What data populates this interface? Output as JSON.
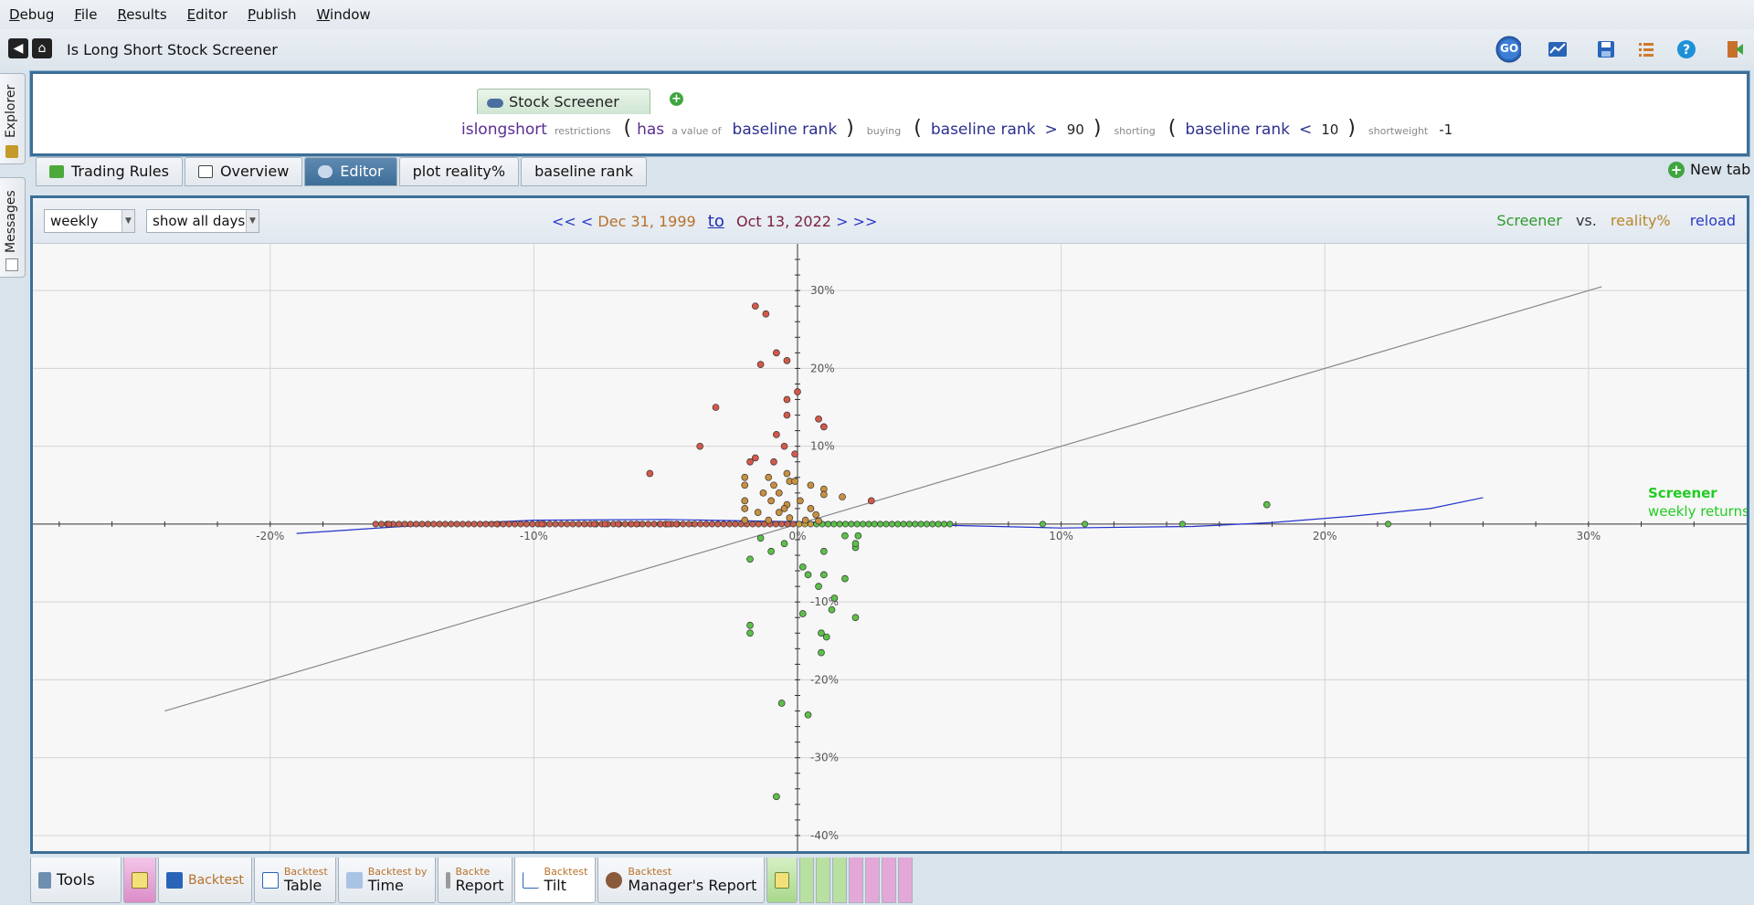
{
  "menu": [
    "Debug",
    "File",
    "Results",
    "Editor",
    "Publish",
    "Window"
  ],
  "title": "Is Long Short Stock Screener",
  "toolbar_icons": [
    "go-icon",
    "chart-icon",
    "save-icon",
    "list-icon",
    "help-icon",
    "exit-icon"
  ],
  "go_label": "GO",
  "side_tabs": [
    "Explorer",
    "Messages"
  ],
  "editor": {
    "tab_label": "Stock Screener",
    "formula": {
      "name": "islongshort",
      "restrictions_label": "restrictions",
      "has": "has",
      "value_of_label": "a value of",
      "restriction_indicator": "baseline rank",
      "buying_label": "buying",
      "buy_indicator": "baseline rank",
      "buy_op": ">",
      "buy_value": "90",
      "shorting_label": "shorting",
      "short_indicator": "baseline rank",
      "short_op": "<",
      "short_value": "10",
      "shortweight_label": "shortweight",
      "shortweight_value": "-1"
    }
  },
  "view_tabs": [
    {
      "label": "Trading Rules",
      "active": false
    },
    {
      "label": "Overview",
      "active": false
    },
    {
      "label": "Editor",
      "active": true
    },
    {
      "label": "plot reality%",
      "active": false
    },
    {
      "label": "baseline rank",
      "active": false
    }
  ],
  "new_tab_label": "New tab",
  "chart_toolbar": {
    "period": "weekly",
    "days": "show all days",
    "nav_back": "<< <",
    "start_date": "Dec 31, 1999",
    "to_label": "to",
    "end_date": "Oct 13, 2022",
    "nav_fwd": "> >>",
    "series_a": "Screener",
    "vs_label": "vs.",
    "series_b": "reality%",
    "reload_label": "reload"
  },
  "chart_data": {
    "type": "scatter",
    "xlabel": "",
    "ylabel": "",
    "x_ticks": [
      "-20%",
      "-10%",
      "0%",
      "10%",
      "20%",
      "30%"
    ],
    "y_ticks": [
      "30%",
      "20%",
      "10%",
      "-10%",
      "-20%",
      "-30%",
      "-40%"
    ],
    "xlim": [
      -29,
      36
    ],
    "ylim": [
      -42,
      36
    ],
    "series_label": "Screener",
    "series_sublabel": "weekly returns",
    "diagonal": [
      [
        -24,
        -24
      ],
      [
        30.5,
        30.5
      ]
    ],
    "trend_curve": [
      [
        -19,
        -1.2
      ],
      [
        -15,
        -0.3
      ],
      [
        -10,
        0.5
      ],
      [
        -5,
        0.6
      ],
      [
        0,
        0.3
      ],
      [
        5,
        -0.1
      ],
      [
        10,
        -0.5
      ],
      [
        15,
        -0.3
      ],
      [
        18,
        0.2
      ],
      [
        21,
        1.0
      ],
      [
        24,
        2.0
      ],
      [
        26,
        3.4
      ]
    ],
    "points_positive": [
      [
        -1.6,
        28
      ],
      [
        -1.2,
        27
      ],
      [
        -0.8,
        22
      ],
      [
        -0.4,
        21
      ],
      [
        -1.4,
        20.5
      ],
      [
        -0.4,
        16
      ],
      [
        0,
        17
      ],
      [
        -3.1,
        15
      ],
      [
        -0.4,
        14
      ],
      [
        0.8,
        13.5
      ],
      [
        1.0,
        12.5
      ],
      [
        -0.8,
        11.5
      ],
      [
        -3.7,
        10
      ],
      [
        -0.5,
        10
      ],
      [
        -0.1,
        9
      ],
      [
        -1.6,
        8.5
      ],
      [
        -0.9,
        8
      ],
      [
        -1.8,
        8
      ],
      [
        -0.4,
        6.5
      ],
      [
        -5.6,
        6.5
      ],
      [
        -1.1,
        6
      ],
      [
        -2.0,
        6
      ],
      [
        -0.3,
        5.5
      ],
      [
        -2.0,
        5
      ],
      [
        -0.9,
        5
      ],
      [
        -0.1,
        5.5
      ],
      [
        0.5,
        5
      ],
      [
        1.0,
        4.5
      ],
      [
        -1.3,
        4
      ],
      [
        -0.7,
        4
      ],
      [
        1.0,
        3.8
      ],
      [
        -2.0,
        3
      ],
      [
        -1.0,
        3
      ],
      [
        -0.4,
        2.5
      ],
      [
        0.1,
        3
      ],
      [
        -2.0,
        2
      ],
      [
        -0.5,
        2
      ],
      [
        0.5,
        2
      ],
      [
        1.7,
        3.5
      ],
      [
        2.8,
        3
      ],
      [
        -1.5,
        1.5
      ],
      [
        -0.7,
        1.5
      ],
      [
        0.7,
        1.2
      ],
      [
        -0.3,
        0.8
      ],
      [
        -2.0,
        0.5
      ],
      [
        -1.1,
        0.5
      ],
      [
        0.3,
        0.5
      ],
      [
        0.8,
        0.4
      ]
    ],
    "points_negative": [
      [
        -1.4,
        -1.8
      ],
      [
        -0.5,
        -2.5
      ],
      [
        -1.8,
        -4.5
      ],
      [
        -1.0,
        -3.5
      ],
      [
        1.8,
        -1.5
      ],
      [
        2.3,
        -1.5
      ],
      [
        2.2,
        -3
      ],
      [
        2.2,
        -2.5
      ],
      [
        1.0,
        -3.5
      ],
      [
        0.2,
        -5.5
      ],
      [
        0.4,
        -6.5
      ],
      [
        1.0,
        -6.5
      ],
      [
        1.8,
        -7
      ],
      [
        0.8,
        -8
      ],
      [
        1.4,
        -9.5
      ],
      [
        0.2,
        -11.5
      ],
      [
        1.3,
        -11
      ],
      [
        2.2,
        -12
      ],
      [
        -1.8,
        -13
      ],
      [
        -1.8,
        -14
      ],
      [
        0.9,
        -14
      ],
      [
        1.1,
        -14.5
      ],
      [
        0.9,
        -16.5
      ],
      [
        -0.6,
        -23
      ],
      [
        0.4,
        -24.5
      ],
      [
        -0.8,
        -35
      ],
      [
        17.8,
        2.5
      ]
    ],
    "points_zero_band_start": -16,
    "points_zero_band_end": 6,
    "points_zero_extra": [
      -15.5,
      -11.4,
      -9.7,
      -7.7,
      -7.3,
      -6.8,
      -6.3,
      -6.1,
      -5.2,
      -5.0,
      -4.9,
      -4.6,
      9.3,
      10.9,
      14.6,
      22.4
    ]
  },
  "bottom_tabs": [
    {
      "type": "tools",
      "label": "Tools"
    },
    {
      "type": "backtest",
      "small": "",
      "label": "Backtest"
    },
    {
      "type": "table",
      "small": "Backtest",
      "label": "Table"
    },
    {
      "type": "time",
      "small": "Backtest by",
      "label": "Time"
    },
    {
      "type": "report",
      "small": "Backte",
      "label": "Report"
    },
    {
      "type": "tilt",
      "small": "Backtest",
      "label": "Tilt"
    },
    {
      "type": "manager",
      "small": "Backtest",
      "label": "Manager's Report"
    }
  ]
}
